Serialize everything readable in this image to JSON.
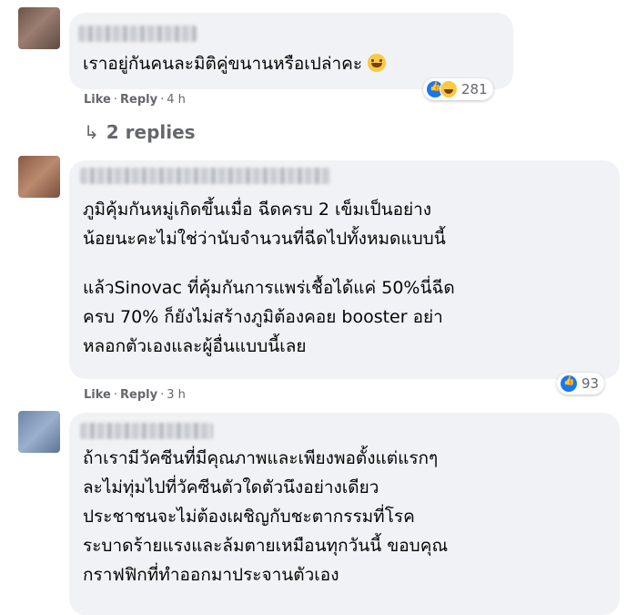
{
  "comments": [
    {
      "text": "เราอยู่กันคนละมิติคู่ขนานหรือเปล่าคะ",
      "actions": {
        "like": "Like",
        "reply": "Reply",
        "time": "4 h"
      },
      "reactions": {
        "types": [
          "like-icon",
          "haha-icon"
        ],
        "count": "281"
      },
      "replies_label": "2 replies"
    },
    {
      "paragraphs": [
        {
          "lines": [
            "ภูมิคุ้มกันหมู่เกิดขึ้นเมื่อ ฉีดครบ 2 เข็มเป็นอย่าง",
            "น้อยนะคะไม่ใช่ว่านับจำนวนที่ฉีดไปทั้งหมดแบบนี้"
          ]
        },
        {
          "lines": [
            "แล้วSinovac ที่คุ้มกันการแพร่เชื้อได้แค่ 50%นี่ฉีด",
            "ครบ 70% ก็ยังไม่สร้างภูมิต้องคอย booster อย่า",
            "หลอกตัวเองและผู้อื่นแบบนี้เลย"
          ]
        }
      ],
      "actions": {
        "like": "Like",
        "reply": "Reply",
        "time": "3 h"
      },
      "reactions": {
        "types": [
          "like-icon"
        ],
        "count": "93"
      }
    },
    {
      "lines": [
        "ถ้าเรามีวัคซีนที่มีคุณภาพและเพียงพอตั้งแต่แรกๆ",
        "ละไม่ทุ่มไปที่วัคซีนตัวใดตัวนึงอย่างเดียว",
        "ประชาชนจะไม่ต้องเผชิญกับชะตากรรมที่โรค",
        "ระบาดร้ายแรงและล้มตายเหมือนทุกวันนี้ ขอบคุณ",
        "กราฟฟิกที่ทำออกมาประจานตัวเอง"
      ]
    }
  ],
  "separator": "·",
  "colors": {
    "bubble": "#f0f2f5",
    "meta": "#65676b",
    "like": "#1877f2"
  }
}
